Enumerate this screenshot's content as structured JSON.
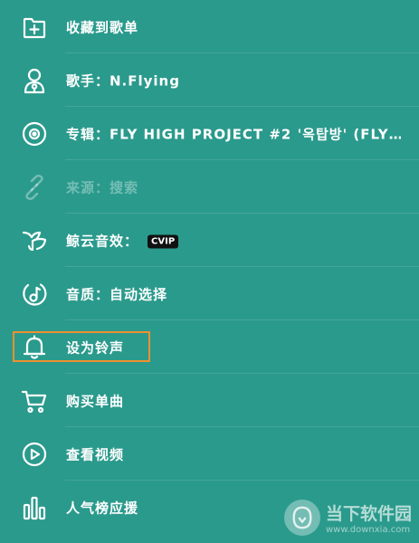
{
  "menu": {
    "items": [
      {
        "label": "收藏到歌单",
        "icon": "add-to-playlist-icon"
      },
      {
        "label": "歌手：N.Flying",
        "icon": "artist-icon"
      },
      {
        "label": "专辑：FLY HIGH PROJECT #2 '옥탑방' (FLY…",
        "icon": "album-disc-icon"
      },
      {
        "label": "来源：搜索",
        "icon": "link-icon"
      },
      {
        "label": "鲸云音效：",
        "icon": "whale-effect-icon",
        "badge": "CVIP"
      },
      {
        "label": "音质：自动选择",
        "icon": "music-note-icon"
      },
      {
        "label": "设为铃声",
        "icon": "bell-icon"
      },
      {
        "label": "购买单曲",
        "icon": "cart-icon"
      },
      {
        "label": "查看视频",
        "icon": "video-play-icon"
      },
      {
        "label": "人气榜应援",
        "icon": "chart-bars-icon"
      }
    ]
  },
  "watermark": {
    "title": "当下软件园",
    "url": "www.downxia.com"
  },
  "colors": {
    "background": "#2a9a8c",
    "highlight": "#f09030",
    "text": "#ffffff"
  }
}
